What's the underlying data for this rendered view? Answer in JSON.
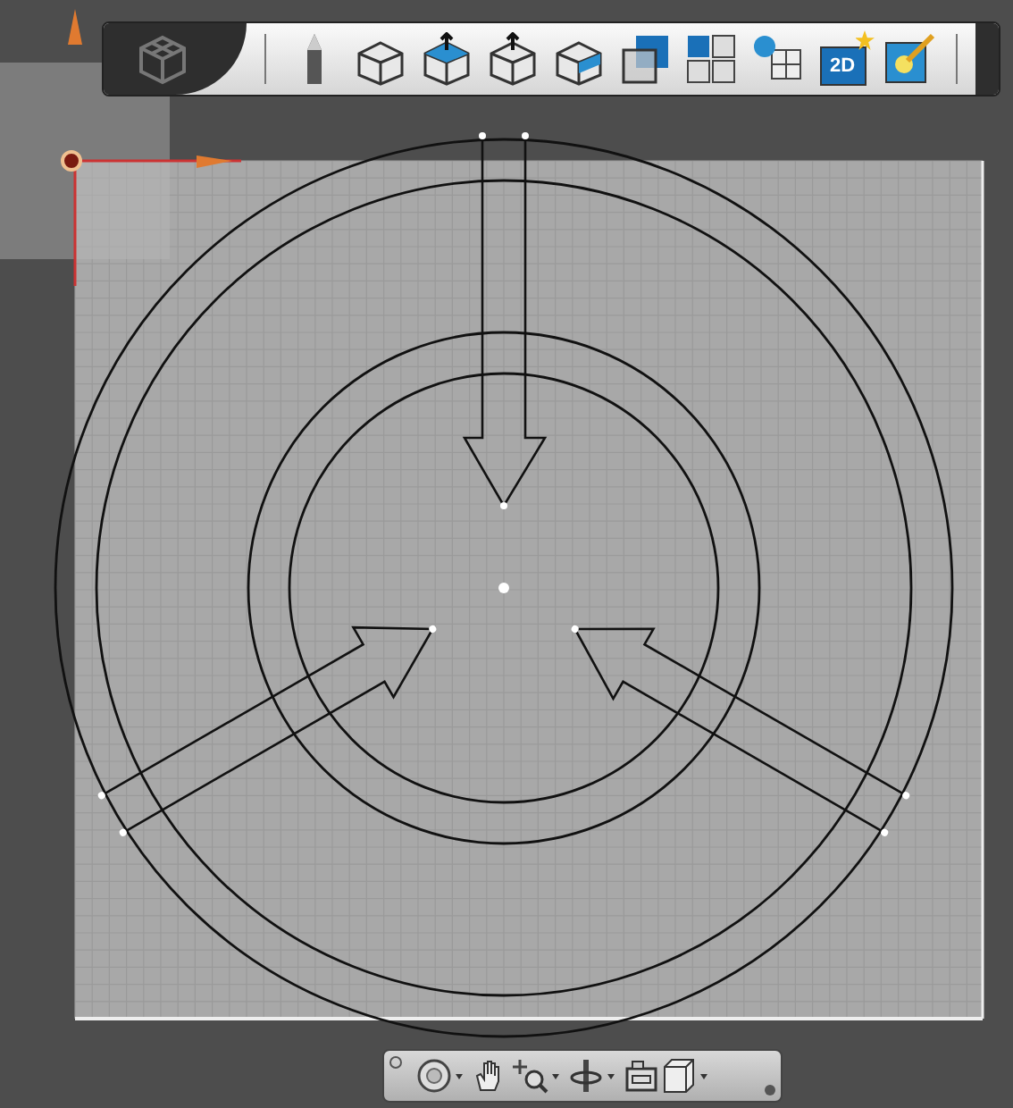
{
  "toolbar": {
    "tools": [
      {
        "kind": "pencil"
      },
      {
        "kind": "cube"
      },
      {
        "kind": "extrude"
      },
      {
        "kind": "move"
      },
      {
        "kind": "section"
      },
      {
        "kind": "overlap"
      },
      {
        "kind": "grid"
      },
      {
        "kind": "blocks"
      },
      {
        "kind": "badge",
        "label": "2D"
      },
      {
        "kind": "render"
      }
    ]
  },
  "nav_bar": {
    "tools": [
      {
        "kind": "wheel",
        "dropdown": true
      },
      {
        "kind": "pan",
        "dropdown": false
      },
      {
        "kind": "zoom",
        "dropdown": true
      },
      {
        "kind": "orbit",
        "dropdown": true
      },
      {
        "kind": "camera",
        "dropdown": false
      },
      {
        "kind": "view-cube",
        "dropdown": true
      }
    ]
  }
}
